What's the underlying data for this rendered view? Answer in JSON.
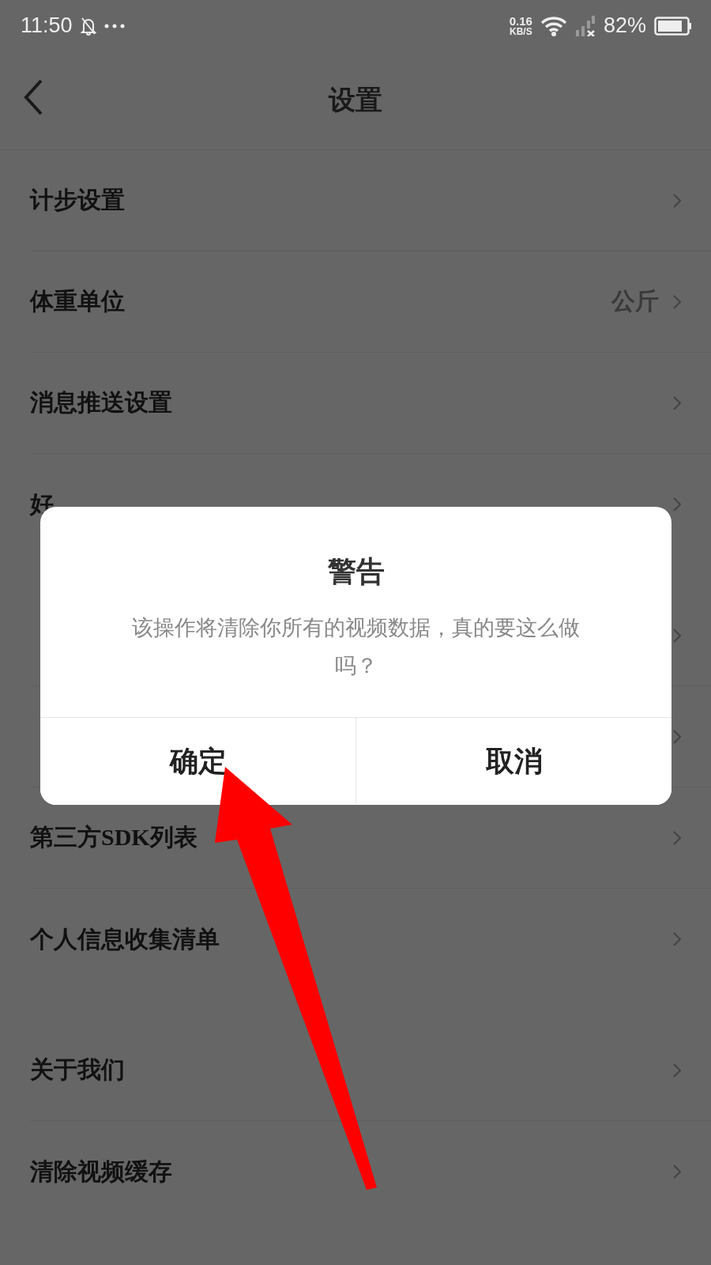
{
  "status_bar": {
    "time": "11:50",
    "speed_value": "0.16",
    "speed_unit": "KB/S",
    "battery": "82%"
  },
  "header": {
    "title": "设置"
  },
  "groups": [
    {
      "rows": [
        {
          "label": "计步设置"
        },
        {
          "label": "体重单位",
          "value": "公斤"
        },
        {
          "label": "消息推送设置"
        },
        {
          "label": "好"
        }
      ]
    },
    {
      "rows": [
        {},
        {},
        {
          "label": "第三方SDK列表"
        },
        {
          "label": "个人信息收集清单"
        }
      ]
    },
    {
      "rows": [
        {
          "label": "关于我们"
        },
        {
          "label": "清除视频缓存"
        }
      ]
    }
  ],
  "dialog": {
    "title": "警告",
    "message": "该操作将清除你所有的视频数据，真的要这么做吗？",
    "buttons": [
      "确定",
      "取消"
    ]
  }
}
